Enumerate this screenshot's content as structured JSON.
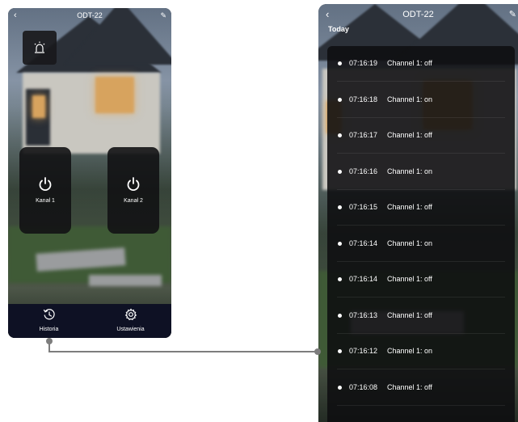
{
  "left_screen": {
    "title": "ODT-22",
    "back_icon": "‹",
    "edit_icon": "✎",
    "alarm_icon": "siren-icon",
    "channels": [
      {
        "label": "Kanał 1",
        "icon": "power-icon"
      },
      {
        "label": "Kanał 2",
        "icon": "power-icon"
      }
    ],
    "nav": [
      {
        "label": "Historia",
        "icon": "history-icon"
      },
      {
        "label": "Ustawienia",
        "icon": "gear-icon"
      }
    ]
  },
  "right_screen": {
    "title": "ODT-22",
    "back_icon": "‹",
    "edit_icon": "✎",
    "section": "Today",
    "entries": [
      {
        "time": "07:16:19",
        "event": "Channel 1: off"
      },
      {
        "time": "07:16:18",
        "event": "Channel 1: on"
      },
      {
        "time": "07:16:17",
        "event": "Channel 1: off"
      },
      {
        "time": "07:16:16",
        "event": "Channel 1: on"
      },
      {
        "time": "07:16:15",
        "event": "Channel 1: off"
      },
      {
        "time": "07:16:14",
        "event": "Channel 1: on"
      },
      {
        "time": "07:16:14",
        "event": "Channel 1: off"
      },
      {
        "time": "07:16:13",
        "event": "Channel 1: off"
      },
      {
        "time": "07:16:12",
        "event": "Channel 1: on"
      },
      {
        "time": "07:16:08",
        "event": "Channel 1: off"
      }
    ]
  },
  "colors": {
    "nav_bg": "#0e1124",
    "card_bg": "#121214",
    "connector": "#7d7d7d"
  }
}
